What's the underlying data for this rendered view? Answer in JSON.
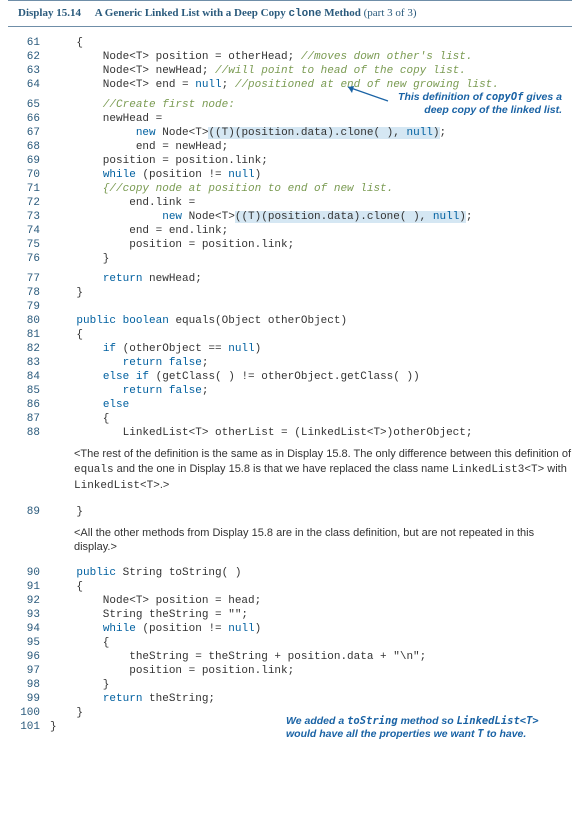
{
  "header": {
    "label": "Display 15.14",
    "title_prefix": "A Generic Linked List with a Deep Copy ",
    "title_code": "clone",
    "title_suffix": " Method",
    "part": " (part 3 of 3)"
  },
  "annotations": {
    "deep_copy_1": "This definition of ",
    "deep_copy_code": "copyOf",
    "deep_copy_2": " gives a",
    "deep_copy_line2": "deep copy of the linked list.",
    "tostring_1": "We added a ",
    "tostring_code1": "toString",
    "tostring_2": " method so ",
    "tostring_code2": "LinkedList<T>",
    "tostring_line2_1": "would have all the properties we want ",
    "tostring_code3": "T",
    "tostring_line2_2": " to have."
  },
  "notes": {
    "equals_1": "<The rest of the definition is the same as in Display 15.8. The only difference between this definition of ",
    "equals_code1": "equals",
    "equals_2": " and the one in Display 15.8 is that we have replaced the class name ",
    "equals_code2": "LinkedList3<T>",
    "equals_3": " with ",
    "equals_code3": "LinkedList<T>",
    "equals_4": ".>",
    "other_methods": "<All the other methods from Display 15.8 are in the class definition, but are not repeated in this display.>"
  },
  "code": {
    "l61": "    {",
    "l62_a": "        Node<T> position = otherHead; ",
    "l62_c": "//moves down other's list.",
    "l63_a": "        Node<T> newHead; ",
    "l63_c": "//will point to head of the copy list.",
    "l64_a": "        Node<T> end = ",
    "l64_null": "null",
    "l64_b": "; ",
    "l64_c": "//positioned at end of new growing list.",
    "l65_c": "        //Create first node:",
    "l66": "        newHead =",
    "l67_a": "             ",
    "l67_new": "new",
    "l67_b": " Node<T>",
    "l67_hl_a": "((T)(position.data).clone( ),",
    "l67_sp": " ",
    "l67_null": "null",
    "l67_hl_b": ")",
    "l67_c": ";",
    "l68": "             end = newHead;",
    "l69": "        position = position.link;",
    "l70_a": "        ",
    "l70_while": "while",
    "l70_b": " (position != ",
    "l70_null": "null",
    "l70_c": ")",
    "l71": "        {//copy node at position to end of new list.",
    "l72": "            end.link =",
    "l73_a": "                 ",
    "l73_new": "new",
    "l73_b": " Node<T>",
    "l73_hl_a": "((T)(position.data).clone( ),",
    "l73_sp": " ",
    "l73_null": "null",
    "l73_hl_b": ")",
    "l73_c": ";",
    "l74": "            end = end.link;",
    "l75": "            position = position.link;",
    "l76": "        }",
    "l77_a": "        ",
    "l77_return": "return",
    "l77_b": " newHead;",
    "l78": "    }",
    "l79": "",
    "l80_a": "    ",
    "l80_public": "public",
    "l80_sp1": " ",
    "l80_boolean": "boolean",
    "l80_b": " equals(Object otherObject)",
    "l81": "    {",
    "l82_a": "        ",
    "l82_if": "if",
    "l82_b": " (otherObject == ",
    "l82_null": "null",
    "l82_c": ")",
    "l83_a": "           ",
    "l83_return": "return",
    "l83_sp": " ",
    "l83_false": "false",
    "l83_c": ";",
    "l84_a": "        ",
    "l84_else": "else",
    "l84_sp": " ",
    "l84_if": "if",
    "l84_b": " (getClass( ) != otherObject.getClass( ))",
    "l85_a": "           ",
    "l85_return": "return",
    "l85_sp": " ",
    "l85_false": "false",
    "l85_c": ";",
    "l86_a": "        ",
    "l86_else": "else",
    "l87": "        {",
    "l88": "           LinkedList<T> otherList = (LinkedList<T>)otherObject;",
    "l89": "    }",
    "l90_a": "    ",
    "l90_public": "public",
    "l90_b": " String toString( )",
    "l91": "    {",
    "l92": "        Node<T> position = head;",
    "l93": "        String theString = \"\";",
    "l94_a": "        ",
    "l94_while": "while",
    "l94_b": " (position != ",
    "l94_null": "null",
    "l94_c": ")",
    "l95": "        {",
    "l96": "            theString = theString + position.data + \"\\n\";",
    "l97": "            position = position.link;",
    "l98": "        }",
    "l99_a": "        ",
    "l99_return": "return",
    "l99_b": " theString;",
    "l100": "    }",
    "l101": "}"
  },
  "chart_data": null
}
